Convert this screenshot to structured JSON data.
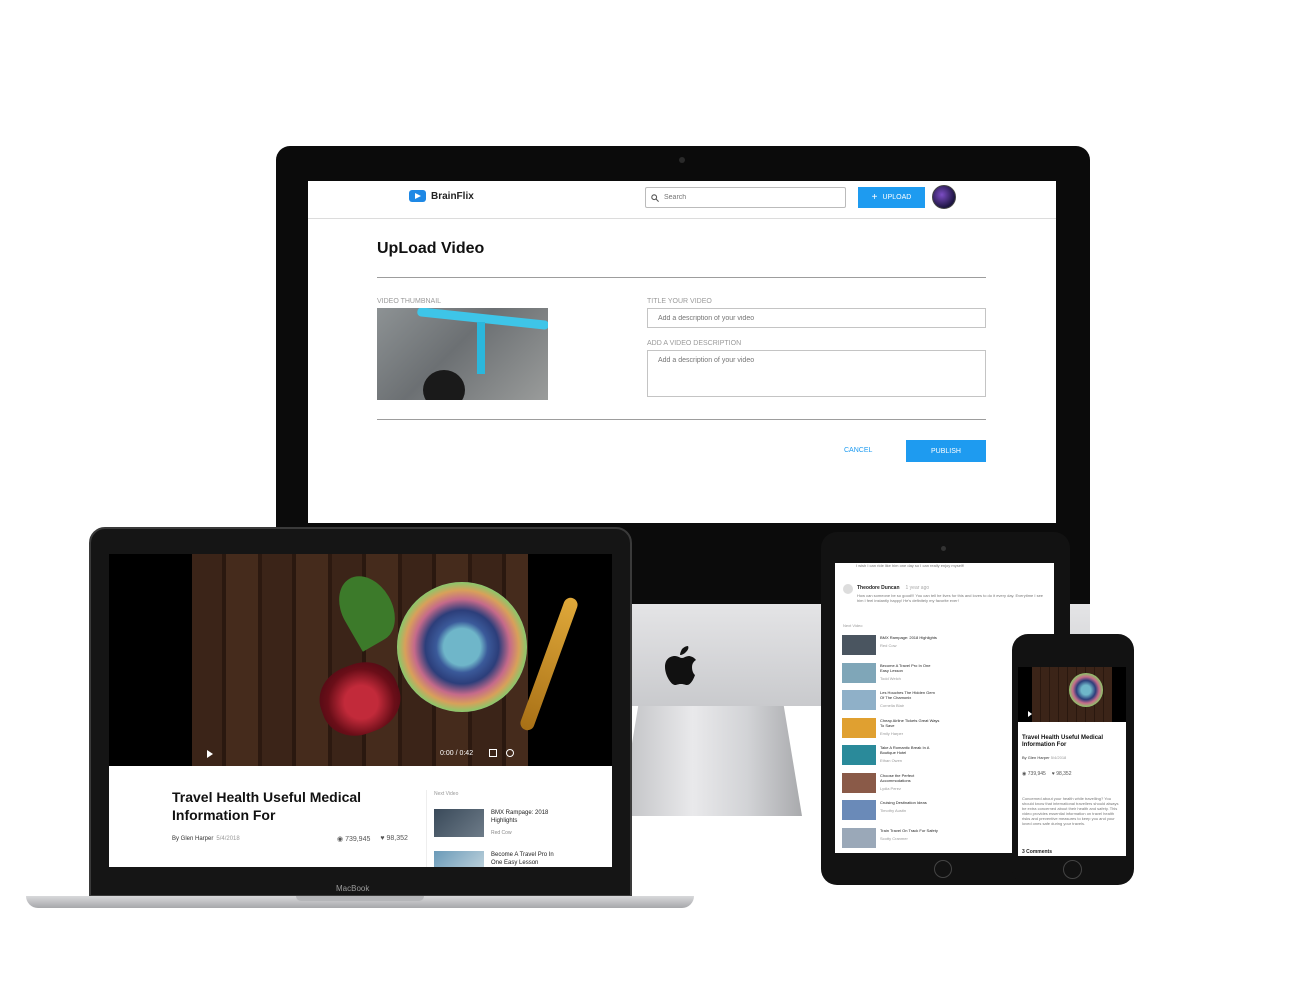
{
  "colors": {
    "accent": "#1e9bf0",
    "brand": "#1e88e5"
  },
  "imac": {
    "header": {
      "logo_text": "BrainFlix",
      "search_placeholder": "Search",
      "upload_label": "UPLOAD"
    },
    "page_title": "UpLoad Video",
    "thumbnail_label": "VIDEO THUMBNAIL",
    "title_label": "TITLE YOUR VIDEO",
    "title_placeholder": "Add a description of your video",
    "description_label": "ADD A VIDEO DESCRIPTION",
    "description_placeholder": "Add a description of your video",
    "cancel_label": "CANCEL",
    "publish_label": "PUBLISH"
  },
  "macbook": {
    "brand_label": "MacBook",
    "video_time": "0:00 / 0:42",
    "title": "Travel Health Useful Medical Information For",
    "author": "By Glen Harper",
    "date": "5/4/2018",
    "views": "739,945",
    "likes": "98,352",
    "next_label": "Next Video",
    "next_videos": [
      {
        "title": "BMX Rampage: 2018 Highlights",
        "channel": "Red Cow"
      },
      {
        "title": "Become A Travel Pro In One Easy Lesson",
        "channel": ""
      }
    ]
  },
  "ipad": {
    "top_comment": "I wish I can ride like him one day so I can really enjoy myself!",
    "commenter": "Theodore Duncan",
    "comment_age": "1 year ago",
    "comment_body": "How can someone be so good!!! You can tell he lives for this and loves to do it every day. Everytime I see him I feel instantly happy! He's definitely my favorite ever!",
    "next_label": "Next Video",
    "next_videos": [
      {
        "title": "BMX Rampage: 2018 Highlights",
        "channel": "Red Cow",
        "color": "#4a5560"
      },
      {
        "title": "Become A Travel Pro In One Easy Lesson",
        "channel": "Todd Welch",
        "color": "#7fa6b8"
      },
      {
        "title": "Les Houches The Hidden Gem Of The Chamonix",
        "channel": "Cornelia Blair",
        "color": "#8fb0c8"
      },
      {
        "title": "Cheap Airline Tickets Great Ways To Save",
        "channel": "Emily Harper",
        "color": "#e0a030"
      },
      {
        "title": "Take A Romantic Break In A Boutique Hotel",
        "channel": "Ethan Owen",
        "color": "#2a8a9a"
      },
      {
        "title": "Choose the Perfect Accommodations",
        "channel": "Lydia Perez",
        "color": "#8a5a48"
      },
      {
        "title": "Cruising Destination Ideas",
        "channel": "Timothy Austin",
        "color": "#6a8ab8"
      },
      {
        "title": "Train Travel On Track For Safety",
        "channel": "Scotty Cranmer",
        "color": "#9aa8b8"
      }
    ]
  },
  "iphone": {
    "title": "Travel Health Useful Medical Information For",
    "author": "By Glen Harper",
    "date": "5/4/2018",
    "views": "739,945",
    "likes": "98,352",
    "description": "Concerned about your health while travelling? You should know that international travellers should always be extra concerned about their health and safety. This video provides essential information on travel health risks and preventive measures to keep you and your loved ones safe during your travels.",
    "comments_count": "3 Comments"
  }
}
